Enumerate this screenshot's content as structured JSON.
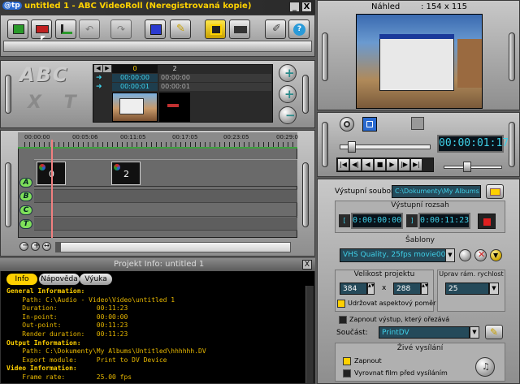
{
  "window": {
    "logo": "@tp",
    "title": "untitled 1 - ABC VideoRoll (Neregistrovaná kopie)",
    "controls": [
      "_",
      "X"
    ]
  },
  "preview": {
    "label": "Náhled",
    "size": ": 154 x 115"
  },
  "player": {
    "time": "00:00:01:17"
  },
  "clip_grid": {
    "logo_top": "ABC",
    "logo_bottom": "X T",
    "col_headers": [
      "0",
      "2"
    ],
    "rows": [
      [
        "00:00:00",
        "00:00:00"
      ],
      [
        "00:00:01",
        "00:00:01"
      ]
    ]
  },
  "timeline": {
    "ticks": [
      "00:00:00",
      "00:05:06",
      "00:11:05",
      "00:17:05",
      "00:23:05",
      "00:29:0"
    ],
    "tracks": [
      "A",
      "B",
      "C",
      "T"
    ],
    "clips": [
      {
        "label": "0"
      },
      {
        "label": "2"
      }
    ]
  },
  "info_panel": {
    "title": "Projekt Info: untitled 1",
    "tabs": [
      "Info",
      "Nápověda",
      "Výuka"
    ],
    "active_tab": "Info",
    "lines": [
      {
        "text": "General Information:",
        "head": true
      },
      {
        "text": "    Path: C:\\Audio - Video\\Video\\untitled 1",
        "head": false
      },
      {
        "text": "    Duration:          00:11:23",
        "head": false
      },
      {
        "text": "    In-point:          00:00:00",
        "head": false
      },
      {
        "text": "    Out-point:         00:11:23",
        "head": false
      },
      {
        "text": "    Render duration:   00:11:23",
        "head": false
      },
      {
        "text": "Output Information:",
        "head": true
      },
      {
        "text": "    Path: C:\\Dokumenty\\My Albums\\Untitled\\hhhhhh.DV",
        "head": false
      },
      {
        "text": "    Export module:     Print to DV Device",
        "head": false
      },
      {
        "text": "Video Information:",
        "head": true
      },
      {
        "text": "    Frame rate:        25.00 fps",
        "head": false
      }
    ]
  },
  "output": {
    "file_label": "Výstupní soubor:",
    "file_value": "C:\\Dokumenty\\My Albums",
    "range_label": "Výstupní rozsah",
    "range_start": "0:00:00:00",
    "range_end": "0:00:11:23",
    "templates_label": "Šablony",
    "template_value": "VHS Quality, 25fps movie002",
    "project_size_label": "Velikost projektu",
    "width": "384",
    "times": "x",
    "height": "288",
    "keep_aspect": "Udržovat aspektový poměr",
    "frame_rate_label": "Uprav rám. rychlost",
    "frame_rate": "25",
    "enable_output": "Zapnout výstup, který ořezává",
    "component_label": "Součást:",
    "component_value": "PrintDV",
    "live_label": "Živé vysílání",
    "live_enable": "Zapnout",
    "live_balance": "Vyrovnat film před vysíláním"
  },
  "colors": {
    "accent": "#ffd200",
    "lcd": "#3fd0e8",
    "info_text": "#e8b800",
    "track": "#7fe05a"
  }
}
